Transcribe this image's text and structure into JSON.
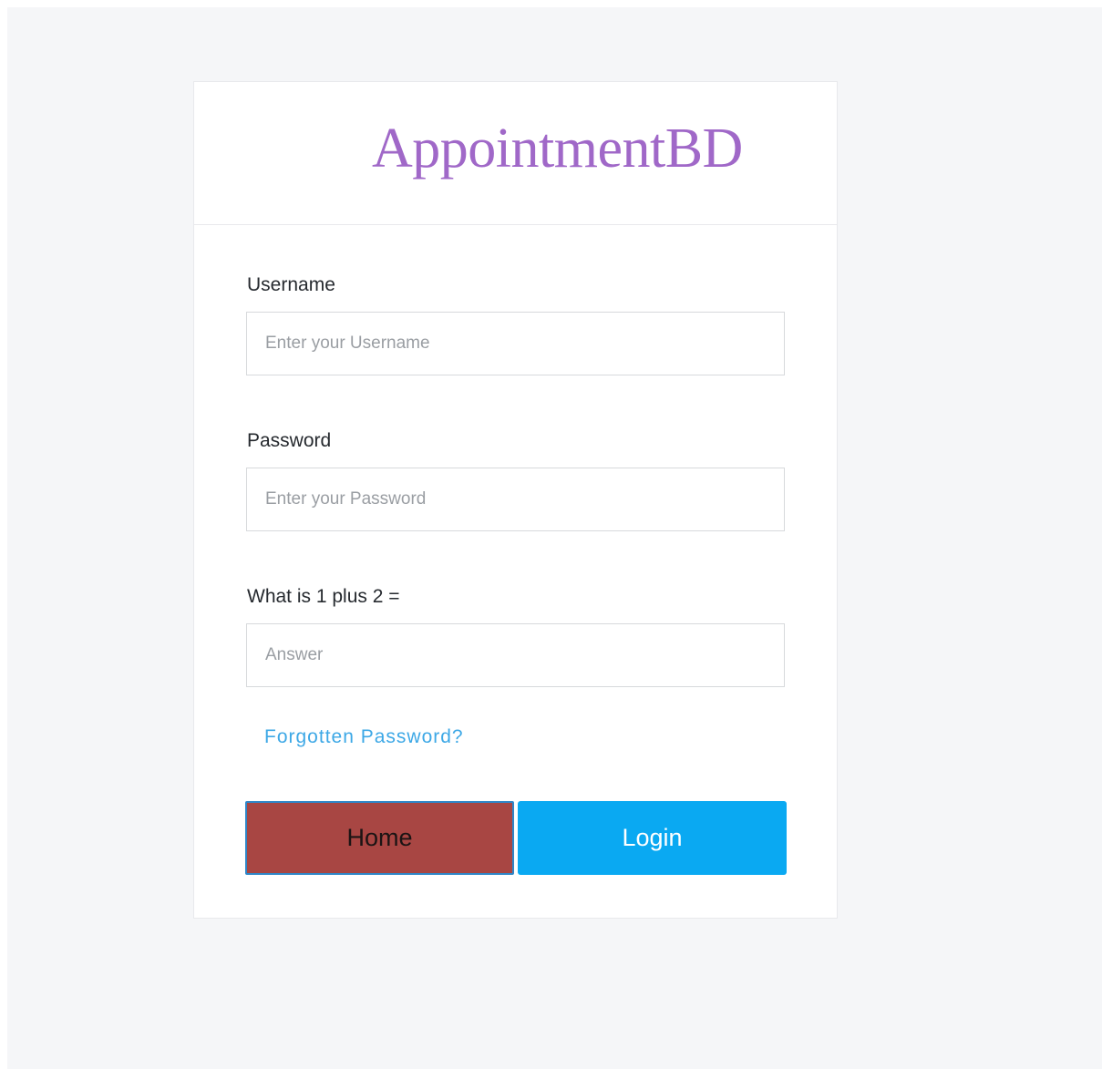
{
  "brand": {
    "name": "AppointmentBD"
  },
  "form": {
    "username": {
      "label": "Username",
      "placeholder": "Enter your Username",
      "value": ""
    },
    "password": {
      "label": "Password",
      "placeholder": "Enter your Password",
      "value": ""
    },
    "captcha": {
      "label": "What is 1 plus 2 =",
      "placeholder": "Answer",
      "value": ""
    },
    "forgot_password_link": "Forgotten Password?",
    "home_button": "Home",
    "login_button": "Login"
  },
  "colors": {
    "page_background": "#f5f6f8",
    "brand_text": "#a068c8",
    "link": "#3da8e6",
    "home_button_bg": "#a84643",
    "home_button_border": "#2f86c8",
    "login_button_bg": "#0aa9f2"
  }
}
